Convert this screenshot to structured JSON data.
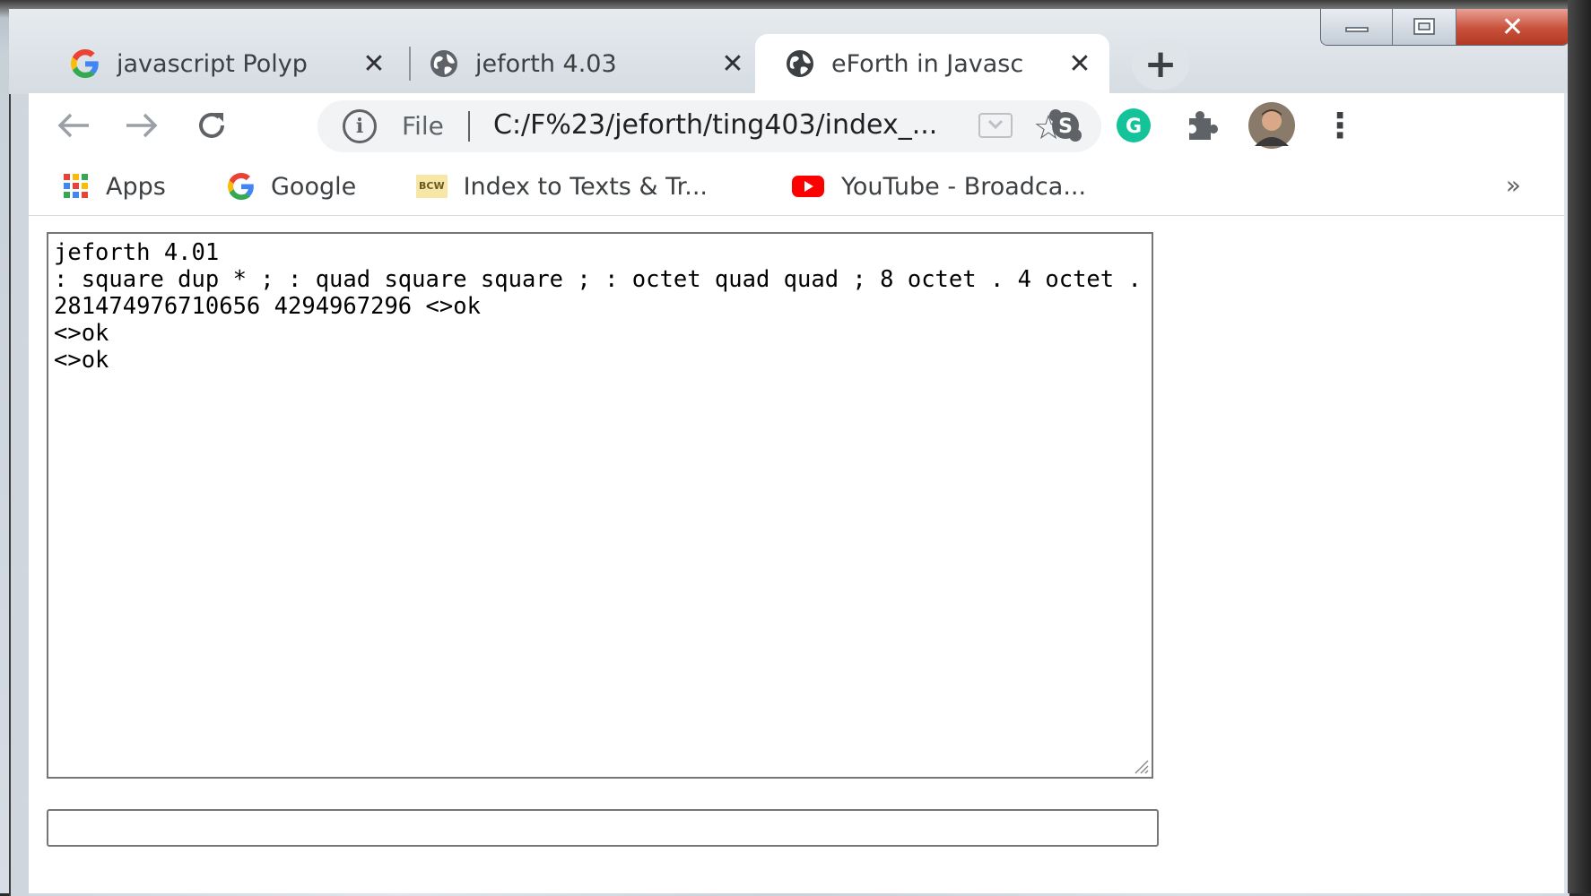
{
  "tabs": [
    {
      "title": "javascript Polyp",
      "favicon": "google-g-icon",
      "active": false
    },
    {
      "title": "jeforth 4.03",
      "favicon": "globe-icon",
      "active": false
    },
    {
      "title": "eForth in Javasc",
      "favicon": "globe-icon",
      "active": true
    }
  ],
  "toolbar": {
    "new_tab": "+",
    "url_scheme": "File",
    "url": "C:/F%23/jeforth/ting403/index_...",
    "star": "☆",
    "menu": "⋮"
  },
  "bookmarks": [
    {
      "label": "Apps",
      "icon": "apps-grid-icon"
    },
    {
      "label": "Google",
      "icon": "google-g-icon"
    },
    {
      "label": "Index to Texts & Tr...",
      "icon": "bcw-icon",
      "badge": "BCW"
    },
    {
      "label": "YouTube - Broadca...",
      "icon": "youtube-icon"
    }
  ],
  "bookmarks_more": "»",
  "console": {
    "text": "jeforth 4.01\n: square dup * ; : quad square square ; : octet quad quad ; 8 octet . 4 octet . 281474976710656 4294967296 <>ok\n<>ok\n<>ok"
  },
  "command": {
    "value": ""
  },
  "colors": {
    "google_blue": "#4285F4",
    "google_red": "#EA4335",
    "google_yellow": "#FBBC05",
    "google_green": "#34A853",
    "grammarly_green": "#15C39A",
    "youtube_red": "#FF0000",
    "close_button_red": "#C9503A"
  }
}
